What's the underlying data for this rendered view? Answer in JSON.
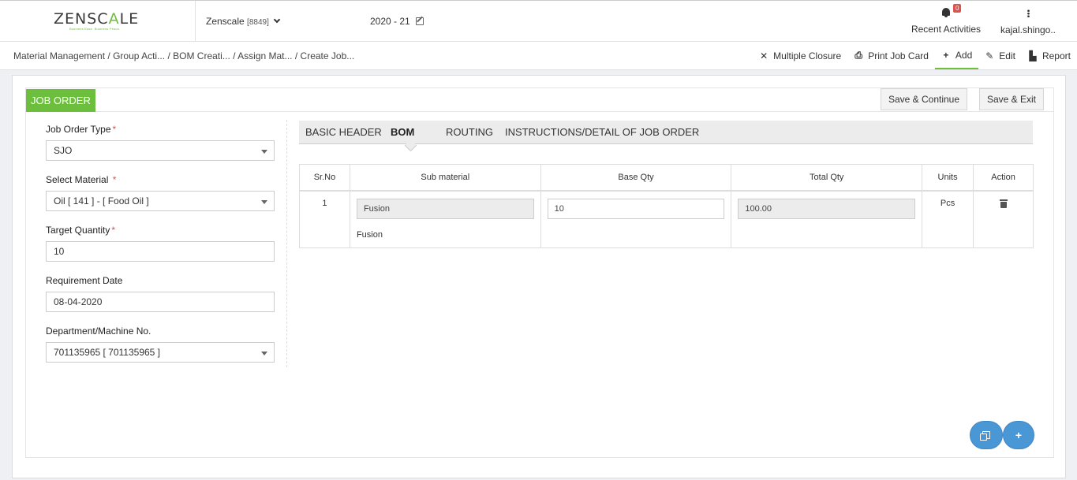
{
  "header": {
    "logo": "ZENSCALE",
    "logo_tagline": "Business Ease. Business Peace.",
    "company_name": "Zenscale",
    "company_code": "[8849]",
    "financial_year": "2020 - 21",
    "notifications_count": "0",
    "recent_activities_label": "Recent Activities",
    "user_name": "kajal.shingo.."
  },
  "breadcrumb": {
    "items": [
      "Material Management",
      "/ Group Acti...",
      "/ BOM Creati...",
      "/ Assign Mat...",
      "/ Create Job..."
    ]
  },
  "actions": {
    "multiple_closure": "Multiple Closure",
    "print_job_card": "Print Job Card",
    "add": "Add",
    "edit": "Edit",
    "report": "Report"
  },
  "panel": {
    "title": "JOB ORDER",
    "save_continue": "Save & Continue",
    "save_exit": "Save & Exit"
  },
  "form": {
    "job_order_type": {
      "label": "Job Order Type",
      "value": "SJO"
    },
    "select_material": {
      "label": "Select Material",
      "value": "Oil [ 141 ] - [ Food Oil ]"
    },
    "target_quantity": {
      "label": "Target Quantity",
      "value": "10"
    },
    "requirement_date": {
      "label": "Requirement Date",
      "value": "08-04-2020"
    },
    "department": {
      "label": "Department/Machine No.",
      "value": "701135965 [ 701135965 ]"
    }
  },
  "tabs": [
    {
      "label": "BASIC HEADER",
      "active": false
    },
    {
      "label": "BOM",
      "active": true
    },
    {
      "label": "ROUTING",
      "active": false
    },
    {
      "label": "INSTRUCTIONS/DETAIL OF JOB ORDER",
      "active": false
    }
  ],
  "bom_table": {
    "columns": [
      "Sr.No",
      "Sub material",
      "Base Qty",
      "Total Qty",
      "Units",
      "Action"
    ],
    "rows": [
      {
        "sr_no": "1",
        "sub_material": "Fusion",
        "sub_material_caption": "Fusion",
        "base_qty": "10",
        "total_qty": "100.00",
        "units": "Pcs"
      }
    ]
  },
  "colors": {
    "accent_green": "#6cbf3c",
    "fab_blue": "#4a97d6",
    "required_red": "#d9534f"
  },
  "icons": [
    "bell-icon",
    "kebab-icon",
    "close-icon",
    "print-icon",
    "plus-icon",
    "edit-icon",
    "file-icon",
    "trash-icon",
    "copy-icon"
  ]
}
